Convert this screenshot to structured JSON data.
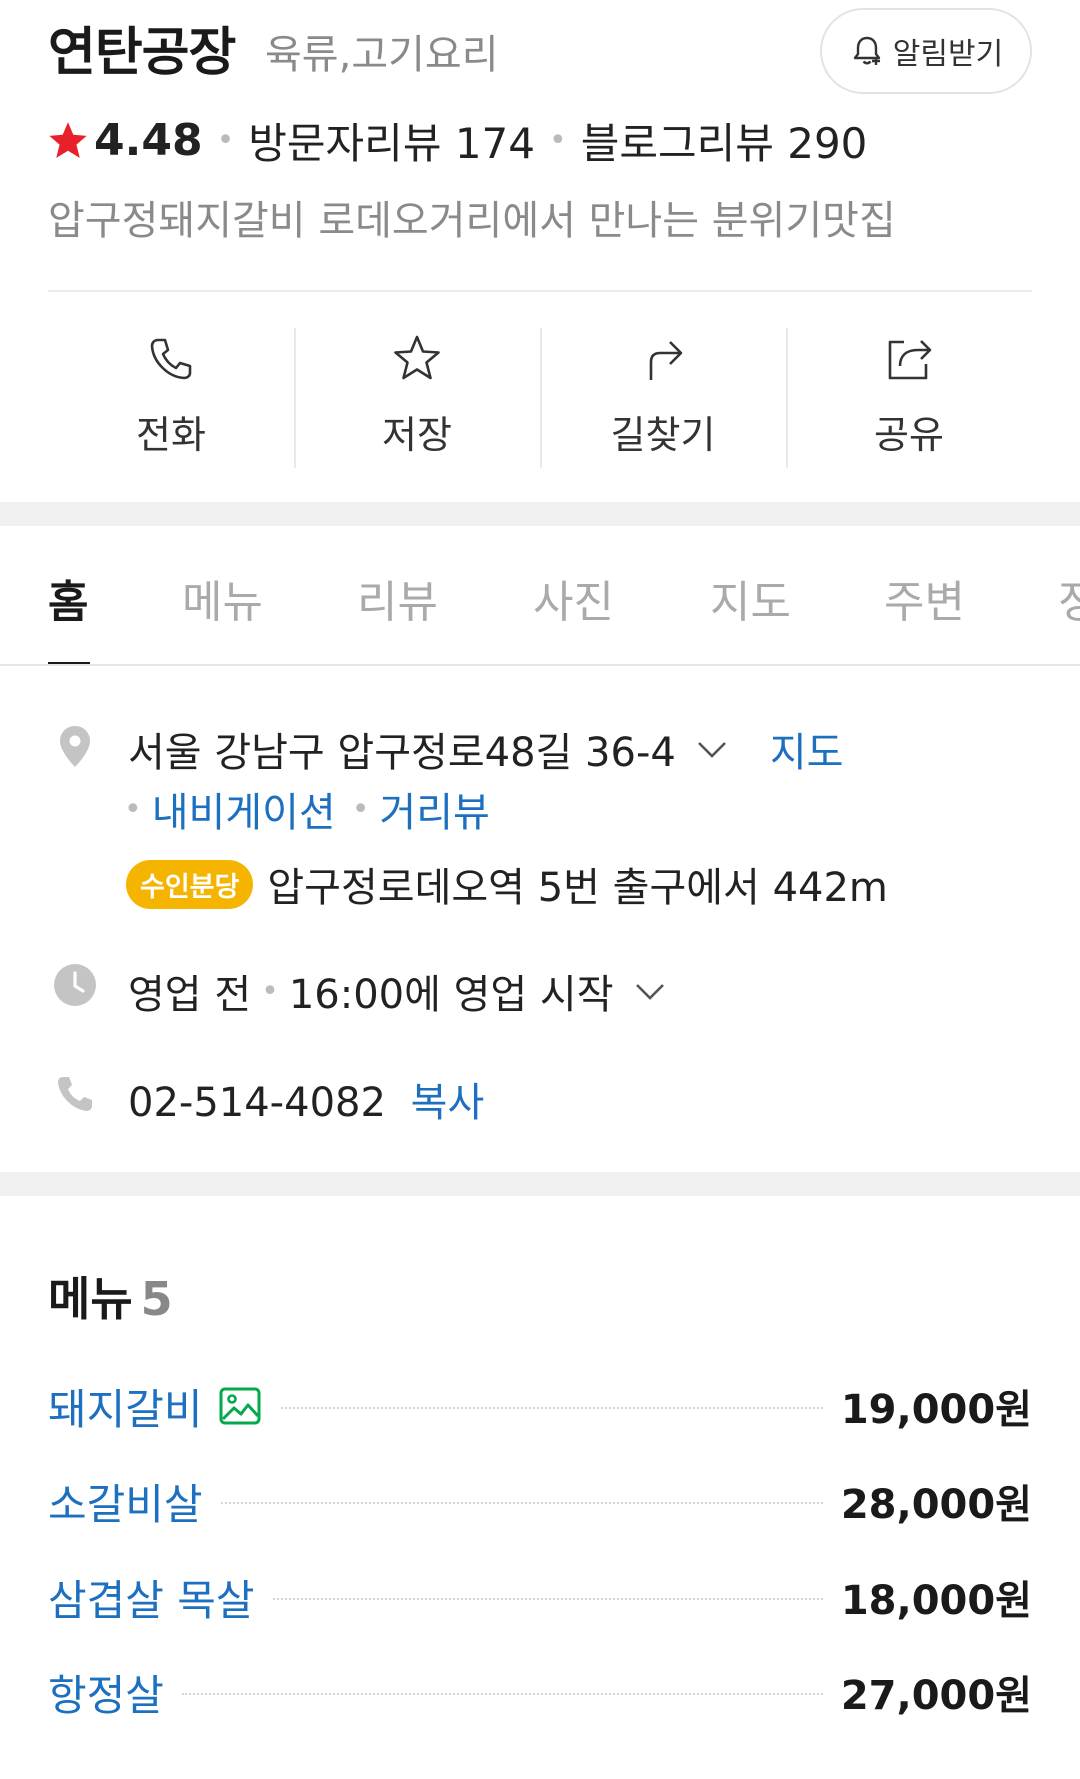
{
  "place": {
    "name": "연탄공장",
    "category": "육류,고기요리",
    "alarm_label": "알림받기",
    "rating": "4.48",
    "visitor_review": "방문자리뷰 174",
    "blog_review": "블로그리뷰 290",
    "description": "압구정돼지갈비 로데오거리에서 만나는 분위기맛집"
  },
  "actions": [
    {
      "label": "전화",
      "icon": "phone-icon"
    },
    {
      "label": "저장",
      "icon": "star-outline-icon"
    },
    {
      "label": "길찾기",
      "icon": "directions-icon"
    },
    {
      "label": "공유",
      "icon": "share-icon"
    }
  ],
  "tabs": [
    "홈",
    "메뉴",
    "리뷰",
    "사진",
    "지도",
    "주변",
    "정"
  ],
  "info": {
    "address": "서울 강남구 압구정로48길 36-4",
    "map_link": "지도",
    "navigation_link": "내비게이션",
    "street_view_link": "거리뷰",
    "subway_line": "수인분당",
    "subway_text": "압구정로데오역 5번 출구에서 442m",
    "hours_status": "영업 전",
    "hours_text": "16:00에 영업 시작",
    "phone": "02-514-4082",
    "copy_label": "복사"
  },
  "menu": {
    "title": "메뉴",
    "count": "5",
    "items": [
      {
        "name": "돼지갈비",
        "price": "19,000원",
        "has_photo": true
      },
      {
        "name": "소갈비살",
        "price": "28,000원",
        "has_photo": false
      },
      {
        "name": "삼겹살 목살",
        "price": "18,000원",
        "has_photo": false
      },
      {
        "name": "항정살",
        "price": "27,000원",
        "has_photo": false
      }
    ]
  },
  "colors": {
    "link": "#1d6fbf",
    "star": "#e8202a",
    "badge": "#f5b400",
    "photo_icon": "#03a94b"
  }
}
